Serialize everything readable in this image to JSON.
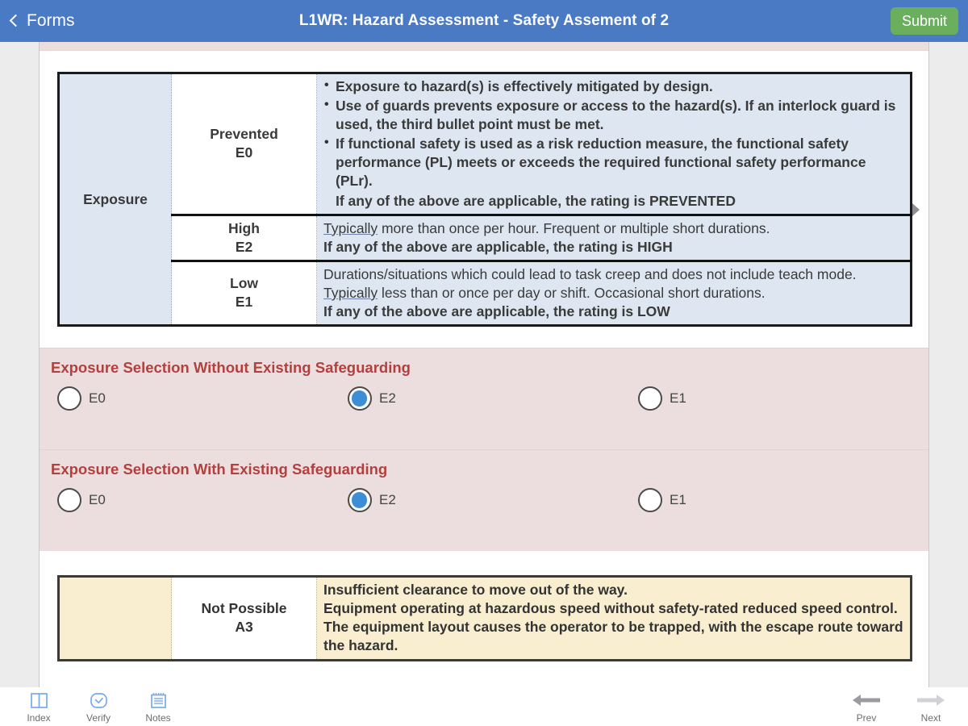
{
  "header": {
    "back_label": "Forms",
    "back_icon": "chevron-left-icon",
    "title": "L1WR: Hazard Assessment - Safety Assement of 2",
    "submit_label": "Submit",
    "bg_color": "#4a7ac4",
    "submit_color": "#6aae5e"
  },
  "exposure_table": {
    "row_label": "Exposure",
    "rows": [
      {
        "rating_name": "Prevented",
        "rating_code": "E0",
        "bullets": [
          "Exposure to hazard(s) is effectively mitigated by design.",
          "Use of guards prevents exposure or access to the hazard(s). If an interlock guard is used, the third bullet point must be met.",
          "If functional safety is used as a risk reduction measure, the functional safety performance (PL) meets or exceeds the required functional safety performance (PLr)."
        ],
        "conclusion": "If any of the above are applicable, the rating is PREVENTED"
      },
      {
        "rating_name": "High",
        "rating_code": "E2",
        "lines": [
          {
            "underlined_lead": "Typically",
            "rest": " more than once per hour.  Frequent or multiple short durations."
          }
        ],
        "conclusion": "If any of the above are applicable, the rating is HIGH"
      },
      {
        "rating_name": "Low",
        "rating_code": "E1",
        "plain_lines": [
          "Durations/situations which could lead to task creep and does not include teach mode."
        ],
        "lines": [
          {
            "underlined_lead": "Typically",
            "rest": " less than or once per day or shift.  Occasional short durations."
          }
        ],
        "conclusion": "If any of the above are applicable, the rating is LOW"
      }
    ],
    "scroll_hint_icon": "chevron-right-icon"
  },
  "radio_sections": [
    {
      "title": "Exposure Selection Without Existing Safeguarding",
      "options": [
        {
          "label": "E0",
          "selected": false
        },
        {
          "label": "E2",
          "selected": true
        },
        {
          "label": "E1",
          "selected": false
        }
      ]
    },
    {
      "title": "Exposure Selection With Existing Safeguarding",
      "options": [
        {
          "label": "E0",
          "selected": false
        },
        {
          "label": "E2",
          "selected": true
        },
        {
          "label": "E1",
          "selected": false
        }
      ]
    }
  ],
  "avoidance_table": {
    "rating_name": "Not Possible",
    "rating_code": "A3",
    "lines": [
      "Insufficient clearance to move out of the way.",
      "Equipment operating at hazardous speed without safety-rated reduced speed control.",
      "The equipment layout causes the operator to be trapped, with the escape route toward the hazard."
    ]
  },
  "toolbar": {
    "left_items": [
      {
        "label": "Index",
        "icon": "book-index-icon"
      },
      {
        "label": "Verify",
        "icon": "check-circle-icon"
      },
      {
        "label": "Notes",
        "icon": "notepad-icon"
      }
    ],
    "right_items": [
      {
        "label": "Prev",
        "icon": "arrow-left-icon",
        "enabled": true
      },
      {
        "label": "Next",
        "icon": "arrow-right-icon",
        "enabled": false
      }
    ]
  },
  "colors": {
    "accent_blue": "#4a7ac4",
    "radio_blue": "#3e8ed6",
    "section_pink": "#ecdede",
    "section_title_red": "#b2403f",
    "table_blue": "#dee6f1",
    "table_yellow": "#f9eecf"
  }
}
